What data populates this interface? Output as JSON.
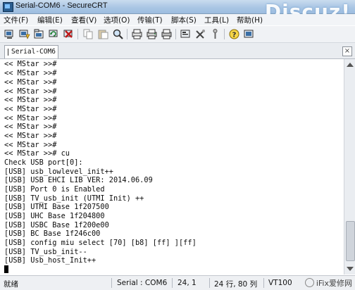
{
  "window": {
    "title": "Serial-COM6 - SecureCRT",
    "watermark": "Discuz!"
  },
  "menu": {
    "items": [
      "文件(F)",
      "编辑(E)",
      "查看(V)",
      "选项(O)",
      "传输(T)",
      "脚本(S)",
      "工具(L)",
      "帮助(H)"
    ]
  },
  "toolbar": {
    "icons": [
      "connect-icon",
      "quick-connect-icon",
      "connect-tab-icon",
      "reconnect-icon",
      "disconnect-icon",
      "copy-icon",
      "paste-icon",
      "find-icon",
      "print-setup-icon",
      "print-icon",
      "print-screen-icon",
      "session-options-icon",
      "keymap-icon",
      "sftp-icon",
      "help-icon",
      "about-icon"
    ]
  },
  "tab": {
    "label": "Serial-COM6",
    "close": "×"
  },
  "terminal": {
    "lines": [
      "<< MStar >>#",
      "<< MStar >>#",
      "<< MStar >>#",
      "<< MStar >>#",
      "<< MStar >>#",
      "<< MStar >>#",
      "<< MStar >>#",
      "<< MStar >>#",
      "<< MStar >>#",
      "<< MStar >>#",
      "<< MStar >># cu",
      "Check USB port[0]:",
      "[USB] usb_lowlevel_init++",
      "[USB] USB EHCI LIB VER: 2014.06.09",
      "[USB] Port 0 is Enabled",
      "[USB] TV_usb_init (UTMI Init) ++",
      "[USB] UTMI Base 1f207500",
      "[USB] UHC Base 1f204800",
      "[USB] USBC Base 1f200e00",
      "[USB] BC Base 1f246c00",
      "[USB] config miu select [70] [b8] [ff] ][ff]",
      "[USB] TV_usb_init--",
      "[USB] Usb_host_Init++"
    ]
  },
  "status": {
    "ready": "就绪",
    "port": "Serial : COM6",
    "position": "24,  1",
    "size": "24 行, 80 列",
    "emulation": "VT100",
    "watermark": "iFix爱修网"
  }
}
